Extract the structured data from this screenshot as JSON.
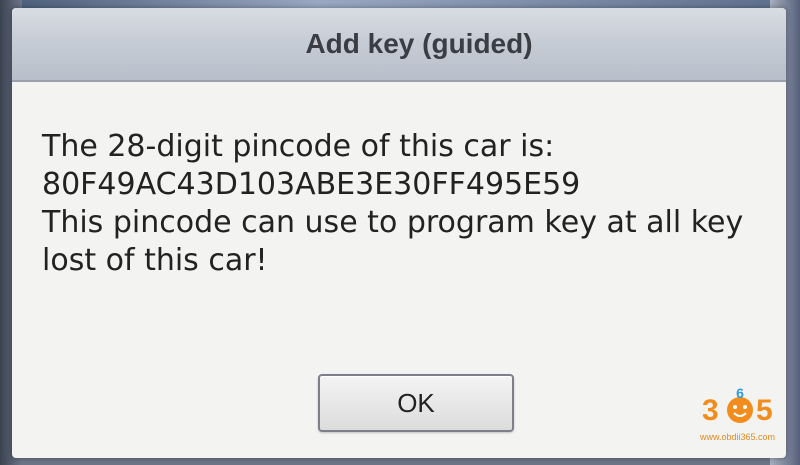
{
  "dialog": {
    "title": "Add key (guided)",
    "message_lines": [
      "The 28-digit pincode of this car is:",
      "80F49AC43D103ABE3E30FF495E59",
      "This pincode can use to program key at all key",
      "lost of this car!"
    ],
    "ok_label": "OK"
  },
  "watermark": {
    "logo_text": "365",
    "url": "www.obdii365.com",
    "brand_color": "#f28c1c"
  }
}
